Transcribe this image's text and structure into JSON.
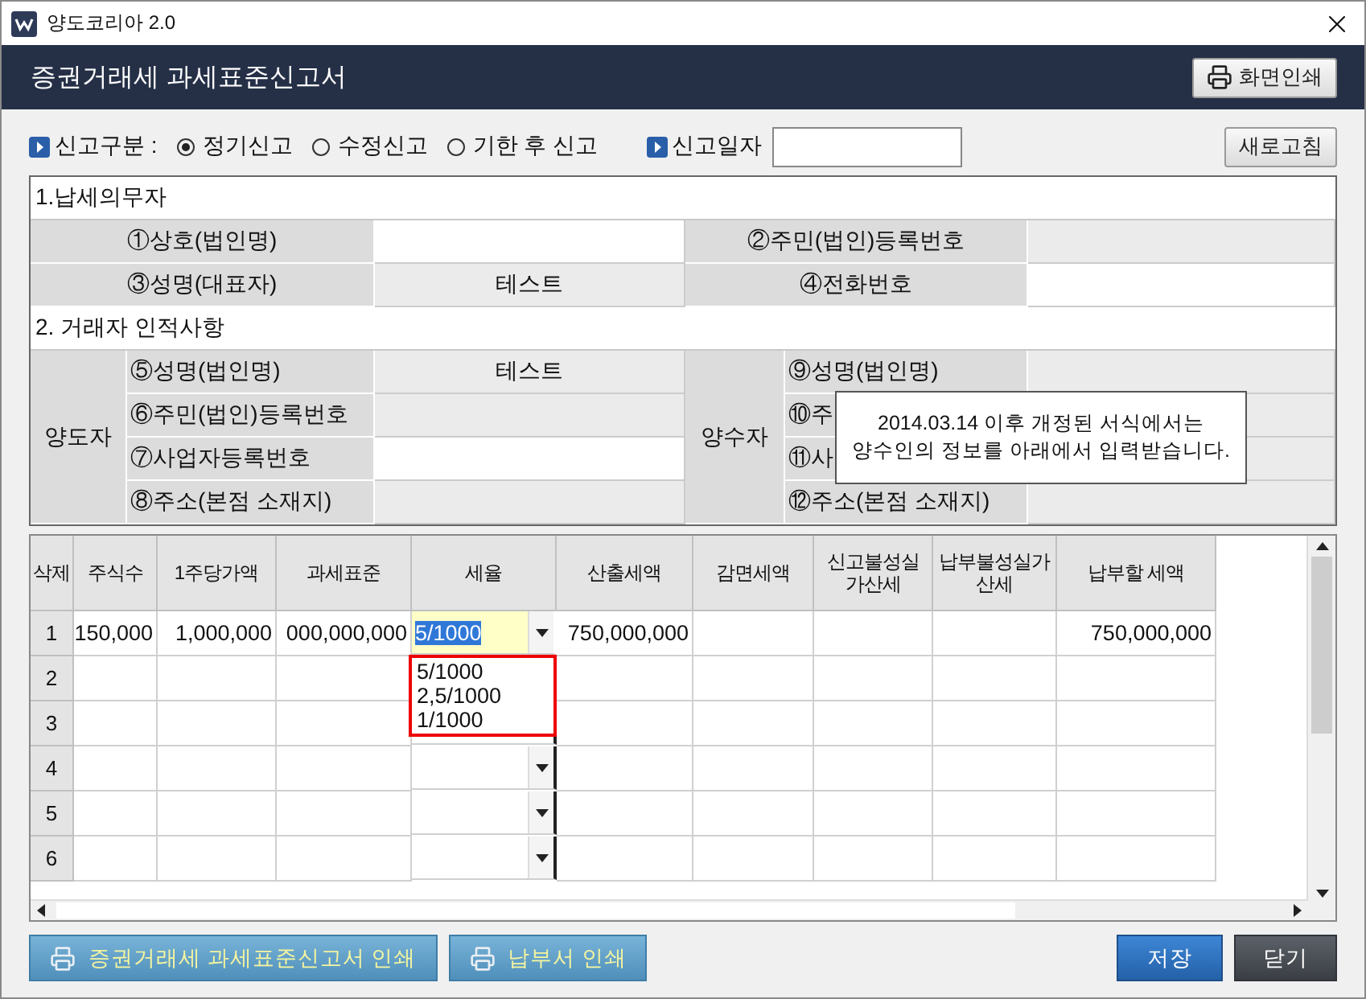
{
  "window": {
    "title": "양도코리아 2.0"
  },
  "header": {
    "title": "증권거래세 과세표준신고서",
    "print_button": "화면인쇄"
  },
  "report_type": {
    "label": "신고구분 :",
    "options": [
      {
        "label": "정기신고",
        "selected": true
      },
      {
        "label": "수정신고",
        "selected": false
      },
      {
        "label": "기한 후 신고",
        "selected": false
      }
    ]
  },
  "report_date": {
    "label": "신고일자"
  },
  "refresh_button": "새로고침",
  "taxpayer": {
    "heading": "1.납세의무자",
    "fields": [
      {
        "label": "①상호(법인명)",
        "kind": "input"
      },
      {
        "label": "②주민(법인)등록번호",
        "kind": "readonly"
      },
      {
        "label": "③성명(대표자)",
        "value": "테스트",
        "kind": "readonly"
      },
      {
        "label": "④전화번호",
        "kind": "input"
      }
    ]
  },
  "parties": {
    "heading": "2. 거래자 인적사항",
    "groups": [
      {
        "label": "양도자",
        "fields": [
          {
            "label": "⑤성명(법인명)",
            "value": "테스트",
            "kind": "readonly"
          },
          {
            "label": "⑥주민(법인)등록번호",
            "kind": "readonly"
          },
          {
            "label": "⑦사업자등록번호",
            "kind": "input"
          },
          {
            "label": "⑧주소(본점 소재지)",
            "kind": "readonly"
          }
        ]
      },
      {
        "label": "양수자",
        "fields": [
          {
            "label": "⑨성명(법인명)",
            "kind": "readonly"
          },
          {
            "label": "⑩주",
            "kind": "readonly"
          },
          {
            "label": "⑪사",
            "kind": "readonly"
          },
          {
            "label": "⑫주소(본점 소재지)",
            "kind": "readonly"
          }
        ]
      }
    ]
  },
  "notice": "2014.03.14 이후 개정된 서식에서는\n양수인의 정보를 아래에서 입력받습니다.",
  "grid": {
    "columns": [
      "삭제",
      "주식수",
      "1주당가액",
      "과세표준",
      "세율",
      "산출세액",
      "감면세액",
      "신고불성실\n가산세",
      "납부불성실가\n산세",
      "납부할 세액"
    ],
    "rows": [
      {
        "cells": [
          "1",
          "150,000",
          "1,000,000",
          "000,000,000",
          "5/1000",
          "750,000,000",
          "",
          "",
          "",
          "750,000,000"
        ],
        "editing": true,
        "dropdown": true
      },
      {
        "cells": [
          "2",
          "",
          "",
          "",
          "",
          "",
          "",
          "",
          "",
          ""
        ]
      },
      {
        "cells": [
          "3",
          "",
          "",
          "",
          "",
          "",
          "",
          "",
          "",
          ""
        ]
      },
      {
        "cells": [
          "4",
          "",
          "",
          "",
          "",
          "",
          "",
          "",
          "",
          ""
        ],
        "editing": false,
        "dropdown": true
      },
      {
        "cells": [
          "5",
          "",
          "",
          "",
          "",
          "",
          "",
          "",
          "",
          ""
        ],
        "editing": false,
        "dropdown": true
      },
      {
        "cells": [
          "6",
          "",
          "",
          "",
          "",
          "",
          "",
          "",
          "",
          ""
        ],
        "editing": false,
        "dropdown": true
      }
    ],
    "rate_options": [
      "5/1000",
      "2,5/1000",
      "1/1000"
    ]
  },
  "buttons": [
    {
      "label": "증권거래세 과세표준신고서 인쇄",
      "kind": "print"
    },
    {
      "label": "납부서 인쇄",
      "kind": "print"
    },
    {
      "label": "저장",
      "kind": "primary"
    },
    {
      "label": "닫기",
      "kind": "dark"
    }
  ]
}
